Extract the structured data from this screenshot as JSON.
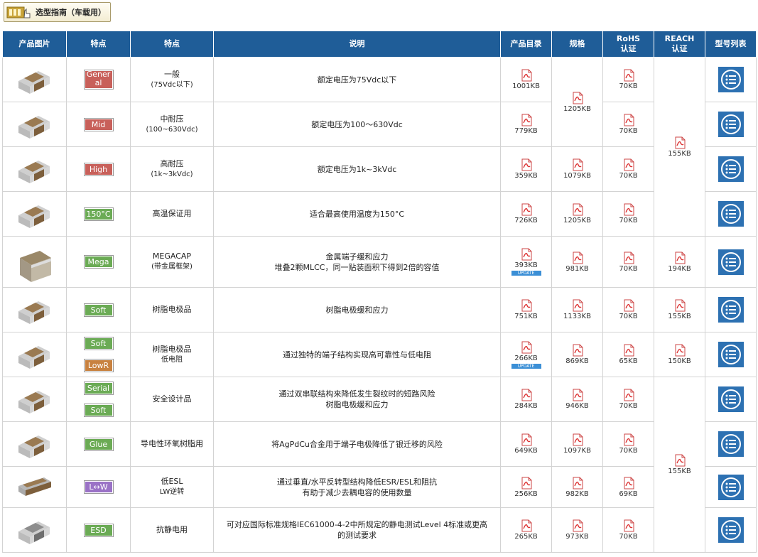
{
  "guide_label": "选型指南（车载用）",
  "headers": {
    "photo": "产品图片",
    "badge": "特点",
    "feature": "特点",
    "desc": "说明",
    "catalog": "产品目录",
    "spec": "规格",
    "rohs": [
      "RoHS",
      "认证"
    ],
    "reach": [
      "REACH",
      "认证"
    ],
    "list": "型号列表"
  },
  "update_label": "UPDATE",
  "colors": {
    "header": "#1f5d98",
    "red_badge": "#c8605a",
    "green_badge": "#6bab55",
    "purple_badge": "#9a72c6",
    "orange_badge": "#c8813f"
  },
  "rows": [
    {
      "badges": [
        {
          "text": "Gener\nal",
          "color": "red"
        }
      ],
      "feature": [
        "一般",
        "(75Vdc以下)"
      ],
      "desc": [
        "额定电压为75Vdc以下"
      ],
      "catalog": "1001KB",
      "rohs": "70KB"
    },
    {
      "badges": [
        {
          "text": "Mid",
          "color": "red"
        }
      ],
      "feature": [
        "中耐压",
        "(100~630Vdc)"
      ],
      "desc": [
        "额定电压为100～630Vdc"
      ],
      "catalog": "779KB",
      "rohs": "70KB"
    },
    {
      "badges": [
        {
          "text": "High",
          "color": "red"
        }
      ],
      "feature": [
        "高耐压",
        "(1k~3kVdc)"
      ],
      "desc": [
        "额定电压为1k~3kVdc"
      ],
      "catalog": "359KB",
      "spec": "1079KB",
      "rohs": "70KB"
    },
    {
      "badges": [
        {
          "text": "150°C",
          "color": "green"
        }
      ],
      "feature": [
        "高温保证用"
      ],
      "desc": [
        "适合最高使用温度为150°C"
      ],
      "catalog": "726KB",
      "spec": "1205KB",
      "rohs": "70KB"
    },
    {
      "badges": [
        {
          "text": "Mega",
          "color": "green"
        }
      ],
      "feature": [
        "MEGACAP",
        "(带金属框架)"
      ],
      "desc": [
        "金属端子缓和应力",
        "堆叠2颗MLCC，同一贴装面积下得到2倍的容值"
      ],
      "catalog": "393KB",
      "catalog_update": true,
      "spec": "981KB",
      "rohs": "70KB",
      "reach": "194KB"
    },
    {
      "badges": [
        {
          "text": "Soft",
          "color": "green"
        }
      ],
      "feature": [
        "树脂电极品"
      ],
      "desc": [
        "树脂电极缓和应力"
      ],
      "catalog": "751KB",
      "spec": "1133KB",
      "rohs": "70KB",
      "reach": "155KB"
    },
    {
      "badges": [
        {
          "text": "Soft",
          "color": "green"
        },
        {
          "text": "LowR",
          "color": "orange"
        }
      ],
      "feature": [
        "树脂电极品",
        "低电阻"
      ],
      "desc": [
        "通过独特的端子结构实现高可靠性与低电阻"
      ],
      "catalog": "266KB",
      "catalog_update": true,
      "spec": "869KB",
      "rohs": "65KB",
      "reach": "150KB"
    },
    {
      "badges": [
        {
          "text": "Serial",
          "color": "green"
        },
        {
          "text": "Soft",
          "color": "green"
        }
      ],
      "feature": [
        "安全设计品"
      ],
      "desc": [
        "通过双串联结构来降低发生裂纹时的短路风险",
        "树脂电极缓和应力"
      ],
      "catalog": "284KB",
      "spec": "946KB",
      "rohs": "70KB"
    },
    {
      "badges": [
        {
          "text": "Glue",
          "color": "green"
        }
      ],
      "feature": [
        "导电性环氧树脂用"
      ],
      "desc": [
        "将AgPdCu合金用于端子电极降低了银迁移的风险"
      ],
      "catalog": "649KB",
      "spec": "1097KB",
      "rohs": "70KB"
    },
    {
      "badges": [
        {
          "text": "L↔W",
          "color": "purple"
        }
      ],
      "feature": [
        "低ESL",
        "LW逆转"
      ],
      "desc": [
        "通过垂直/水平反转型结构降低ESR/ESL和阻抗",
        "有助于减少去耦电容的使用数量"
      ],
      "catalog": "256KB",
      "spec": "982KB",
      "rohs": "69KB"
    },
    {
      "badges": [
        {
          "text": "ESD",
          "color": "green"
        }
      ],
      "feature": [
        "抗静电用"
      ],
      "desc": [
        "可对应国际标准规格IEC61000-4-2中所规定的静电测试Level 4标准或更高",
        "的测试要求"
      ],
      "catalog": "265KB",
      "spec": "973KB",
      "rohs": "70KB"
    }
  ],
  "merged": {
    "spec_rows_1_2": "1205KB",
    "reach_rows_1_4": "155KB",
    "reach_rows_8_11": "155KB"
  },
  "chip_styles": [
    "brown",
    "brown",
    "brown",
    "brown",
    "mega",
    "brown",
    "brown",
    "brown",
    "brown",
    "lw",
    "gray"
  ]
}
